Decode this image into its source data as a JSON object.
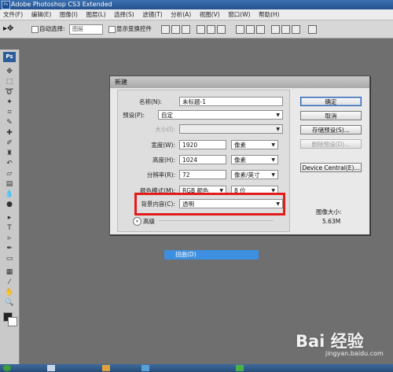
{
  "app": {
    "icon_text": "Ps",
    "title": "Adobe Photoshop CS3 Extended"
  },
  "menu": [
    "文件(F)",
    "编辑(E)",
    "图像(I)",
    "图层(L)",
    "选择(S)",
    "滤镜(T)",
    "分析(A)",
    "视图(V)",
    "窗口(W)",
    "帮助(H)"
  ],
  "options": {
    "auto_select": "自动选择:",
    "layer_select": "图层",
    "show_transform": "显示变换控件"
  },
  "toolbox": {
    "ps_label": "Ps"
  },
  "dialog": {
    "title": "新建",
    "name_label": "名称(N):",
    "name_value": "未标题-1",
    "preset_label": "预设(P):",
    "preset_value": "自定",
    "size_label": "大小(I):",
    "width_label": "宽度(W):",
    "width_value": "1920",
    "width_unit": "像素",
    "height_label": "高度(H):",
    "height_value": "1024",
    "height_unit": "像素",
    "resolution_label": "分辨率(R):",
    "resolution_value": "72",
    "resolution_unit": "像素/英寸",
    "color_mode_label": "颜色模式(M):",
    "color_mode_value": "RGB 颜色",
    "bit_depth": "8 位",
    "background_label": "背景内容(C):",
    "background_value": "透明",
    "advanced_label": "高级",
    "ok": "确定",
    "cancel": "取消",
    "save_preset": "存储预设(S)...",
    "delete_preset": "删除预设(D)...",
    "device_central": "Device Central(E)...",
    "image_size_label": "图像大小:",
    "image_size_value": "5.63M"
  },
  "highlight_item": "扭曲(D)",
  "watermark": {
    "text": "Bai 经验",
    "sub": "jingyan.baidu.com"
  }
}
